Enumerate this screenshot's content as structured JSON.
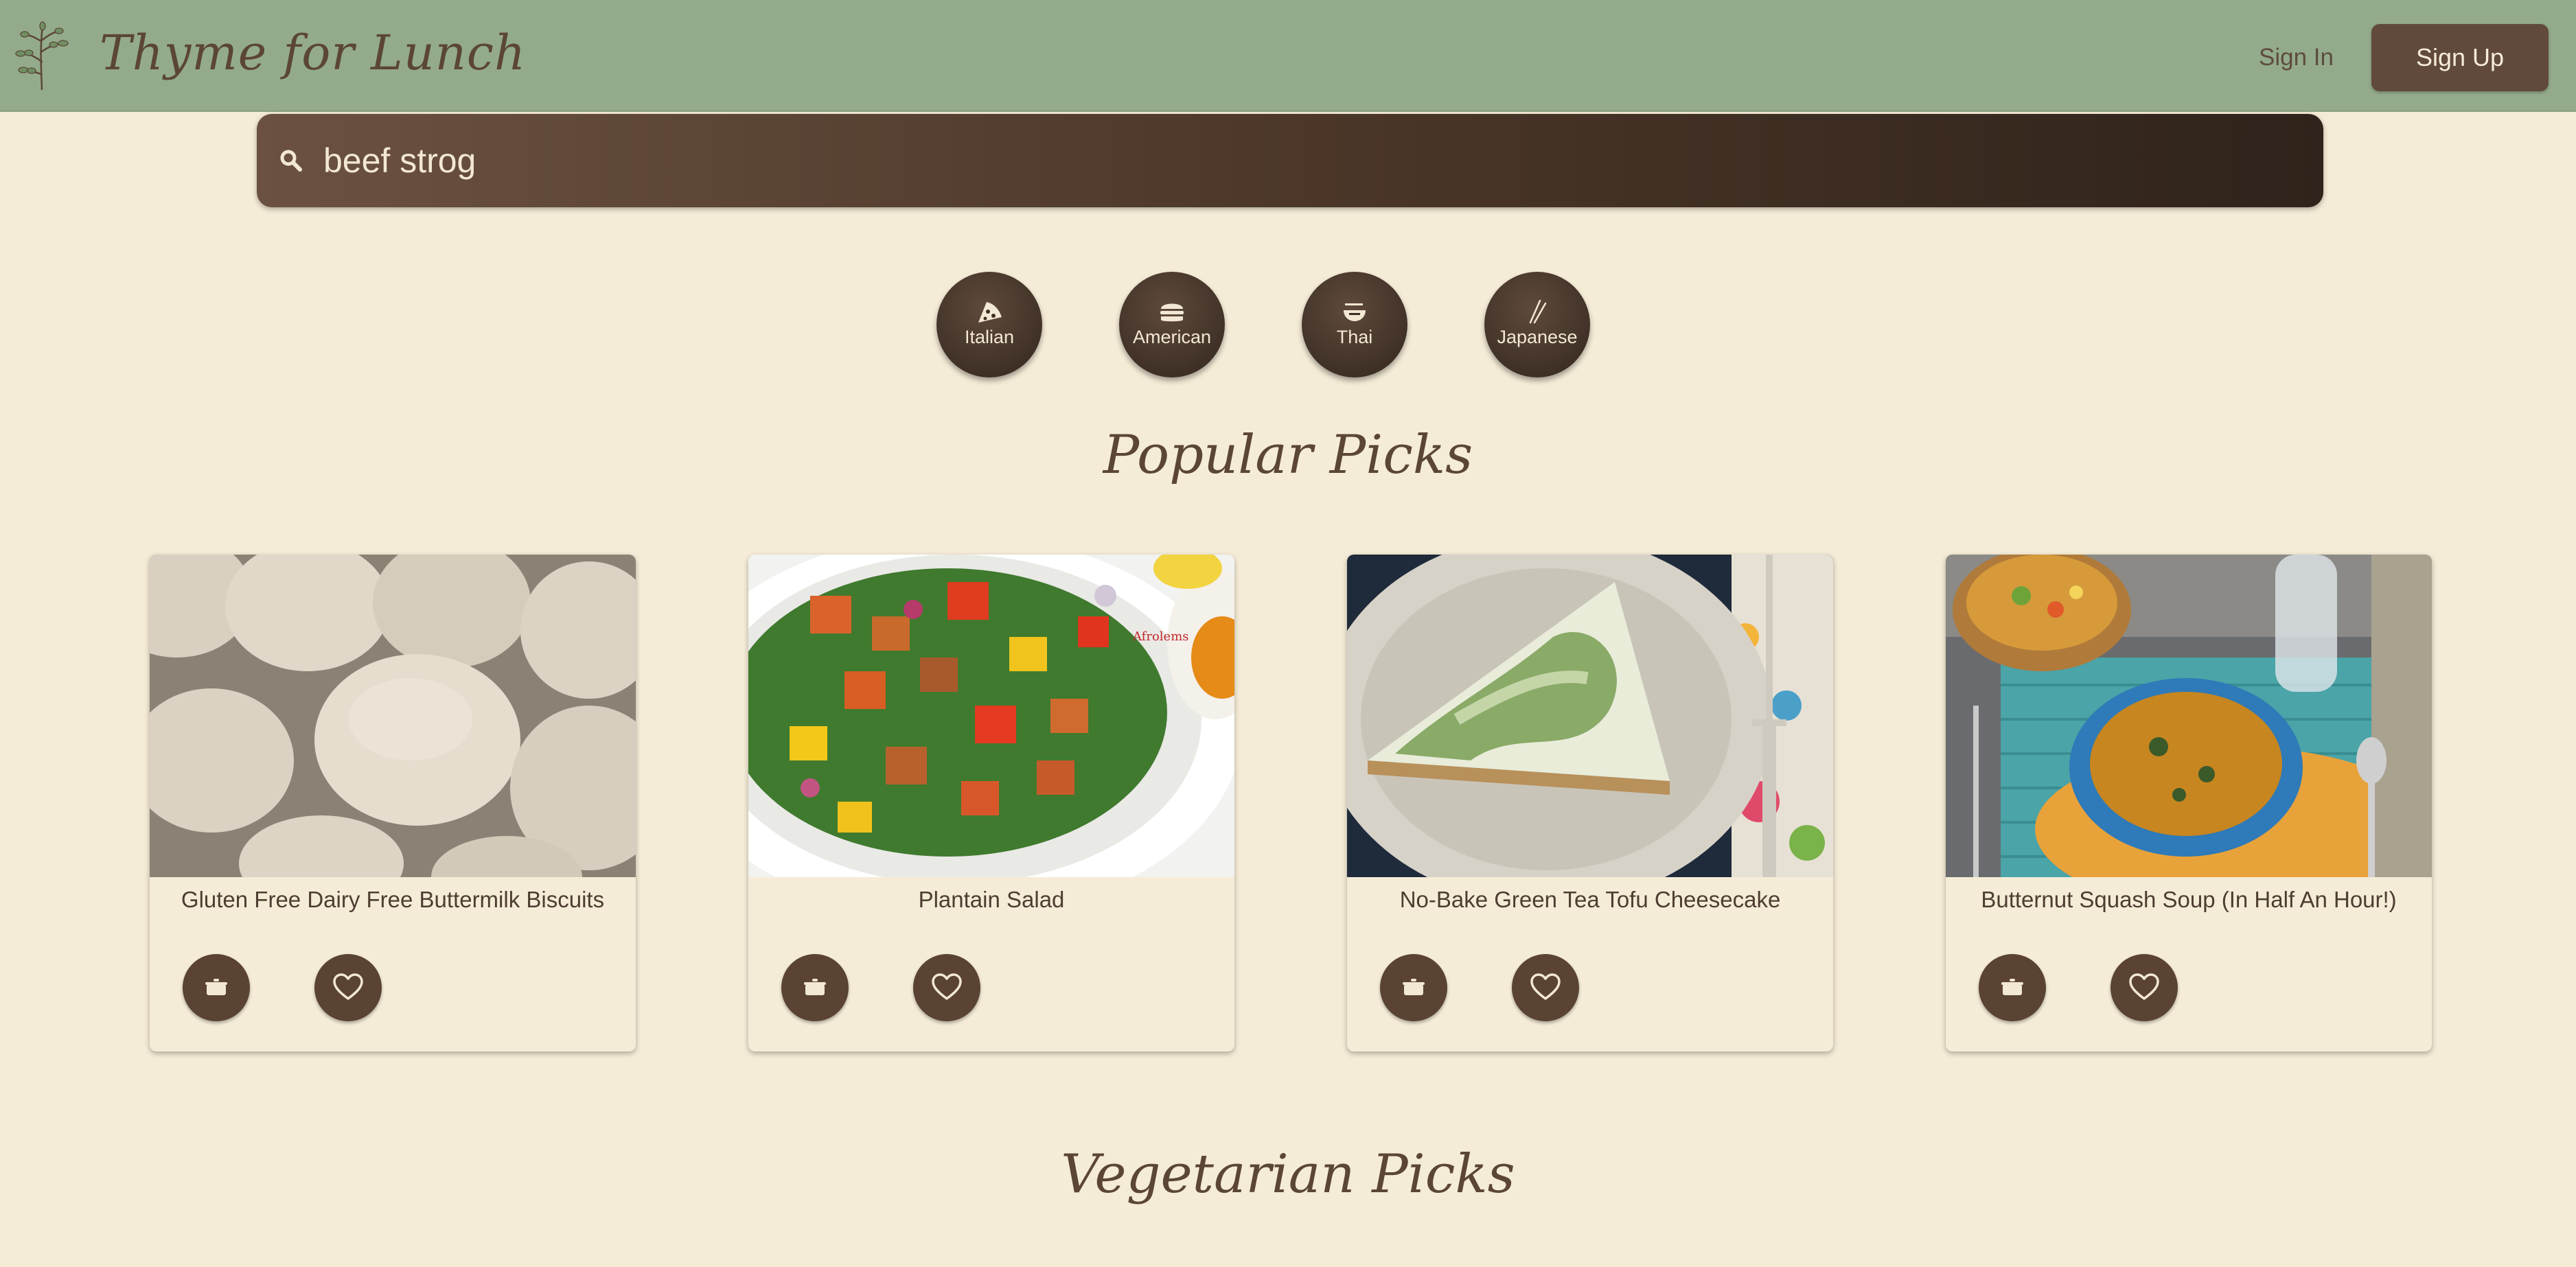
{
  "header": {
    "brand": "Thyme for Lunch",
    "logo_icon": "herb-sprig-icon",
    "sign_in_label": "Sign In",
    "sign_up_label": "Sign Up",
    "colors": {
      "bar": "#93ab8a",
      "button": "#614a3b"
    }
  },
  "search": {
    "value": "beef strog",
    "icon": "search-icon"
  },
  "cuisines": [
    {
      "label": "Italian",
      "icon": "pizza-icon"
    },
    {
      "label": "American",
      "icon": "burger-icon"
    },
    {
      "label": "Thai",
      "icon": "noodle-bowl-icon"
    },
    {
      "label": "Japanese",
      "icon": "chopsticks-icon"
    }
  ],
  "sections": {
    "popular_title": "Popular Picks",
    "vegetarian_title": "Vegetarian Picks"
  },
  "cards": [
    {
      "title": "Gluten Free Dairy Free Buttermilk Biscuits",
      "cook_icon": "cooking-pot-icon",
      "favorite_icon": "heart-icon"
    },
    {
      "title": "Plantain Salad",
      "photo_watermark": "Afrolems",
      "cook_icon": "cooking-pot-icon",
      "favorite_icon": "heart-icon"
    },
    {
      "title": "No-Bake Green Tea Tofu Cheesecake",
      "cook_icon": "cooking-pot-icon",
      "favorite_icon": "heart-icon"
    },
    {
      "title": "Butternut Squash Soup (In Half An Hour!)",
      "cook_icon": "cooking-pot-icon",
      "favorite_icon": "heart-icon"
    }
  ],
  "colors": {
    "background": "#f5ecd7",
    "accent_brown": "#5a4333"
  }
}
